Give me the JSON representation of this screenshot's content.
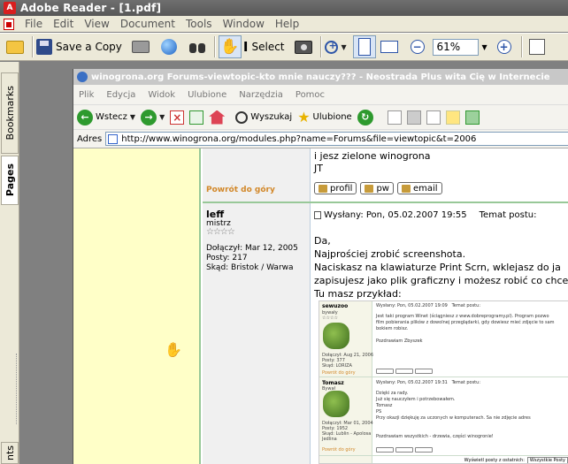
{
  "window": {
    "title": "Adobe Reader - [1.pdf]"
  },
  "menu": [
    "File",
    "Edit",
    "View",
    "Document",
    "Tools",
    "Window",
    "Help"
  ],
  "toolbar": {
    "save_copy": "Save a Copy",
    "select": "Select",
    "zoom_value": "61%"
  },
  "nav_tabs": {
    "bookmarks": "Bookmarks",
    "pages": "Pages",
    "comments": "nts"
  },
  "ie": {
    "title": "winogrona.org Forums-viewtopic-kto mnie nauczy??? - Neostrada Plus wita Cię w Internecie",
    "menu": [
      "Plik",
      "Edycja",
      "Widok",
      "Ulubione",
      "Narzędzia",
      "Pomoc"
    ],
    "back": "Wstecz",
    "search": "Wyszukaj",
    "favorites": "Ulubione",
    "address_label": "Adres",
    "address": "http://www.winogrona.org/modules.php?name=Forums&file=viewtopic&t=2006"
  },
  "prev_post": {
    "line1": "i jesz zielone winogrona",
    "line2": "JT"
  },
  "back_to_top": "Powrót do góry",
  "buttons": {
    "profile": "profil",
    "pm": "pw",
    "email": "email"
  },
  "author": {
    "name": "leff",
    "rank": "mistrz",
    "stars": "☆☆☆☆",
    "joined": "Dołączył: Mar 12, 2005",
    "posts": "Posty: 217",
    "location": "Skąd: Bristok / Warwa"
  },
  "post": {
    "header": "Wysłany: Pon, 05.02.2007 19:55",
    "subject": "Temat postu:",
    "body": "Da,\nNajprościej zrobić screenshota.\nNaciskasz na klawiaturze Print Scrn, wklejasz do ja\nzapisujesz jako plik graficzny i możesz robić co chce\nTu masz przykład:"
  },
  "nested": {
    "row1": {
      "name": "sewuzoo",
      "rank": "bywały",
      "stars": "☆☆☆☆",
      "meta": "Dołączył: Aug 21, 2006\nPosty: 377\nSkąd: LORIZA",
      "header": "Wysłany: Pon, 05.02.2007 19:09   Temat postu:",
      "text": "Jest taki program Winet (ściągniesz z www.dobreprogramy.pl). Program pozwo\nfilm pobierania plików z dowolnej przeglądarki, gdy dowiesz mieć zdjęcie to sam\nbokiem robisz.\n\nPozdrawiam Zbyszek"
    },
    "row2": {
      "name": "Tomasz",
      "rank": "Bywał",
      "meta": "Dołączył: Mar 01, 2004\nPosty: 1952\nSkąd: Lublin - Apolosa\nJedlina",
      "header": "Wysłany: Pon, 05.02.2007 19:31   Temat postu:",
      "text": "Dzięki za rady.\nJuż się nauczyłem i potrzebowałem.\nTomasz\nPS\nPrzy okazji dziękuję za uczonych w komputerach. Sa nie zdjęcie adres\n\n\nPozdrawiam wszystkich - drzewia, części winogronie!"
    },
    "back": "Powrót do góry",
    "footer_label": "Wyświetl posty z ostatnich:",
    "footer_select": "Wszystkie Posty"
  }
}
